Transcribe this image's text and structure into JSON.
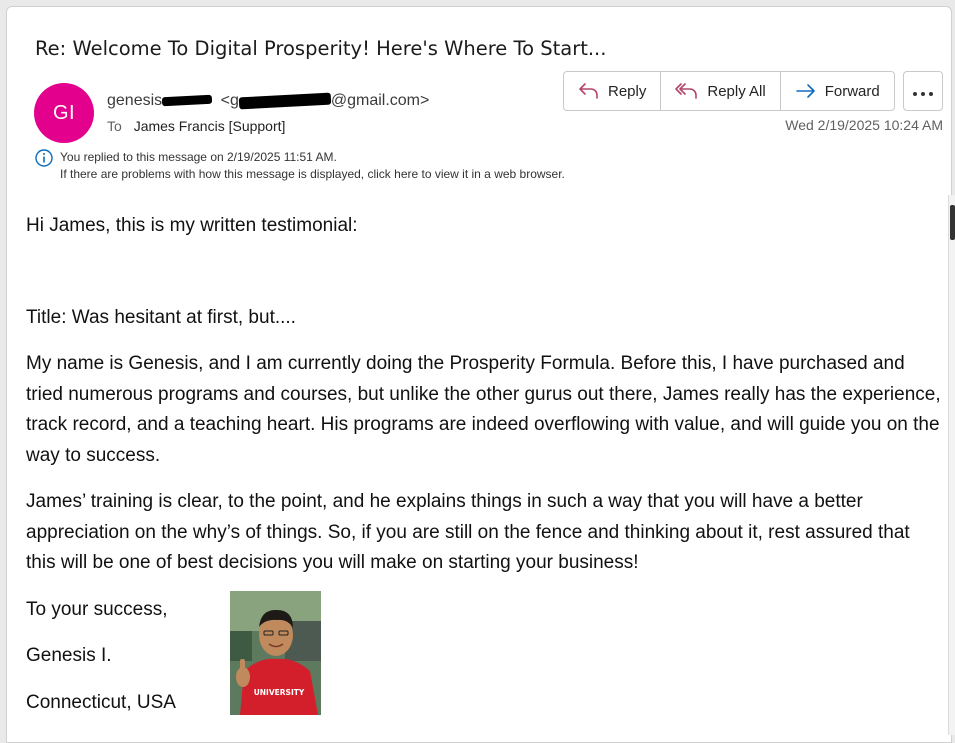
{
  "email": {
    "subject": "Re: Welcome To Digital Prosperity! Here's Where To Start...",
    "avatar_initials": "GI",
    "sender_name_visible": "genesis",
    "sender_email_prefix": "<g",
    "sender_email_suffix": "@gmail.com>",
    "to_label": "To",
    "to_value": "James Francis [Support]",
    "date": "Wed 2/19/2025 10:24 AM",
    "info_line1": "You replied to this message on 2/19/2025 11:51 AM.",
    "info_line2": "If there are problems with how this message is displayed, click here to view it in a web browser."
  },
  "actions": {
    "reply": "Reply",
    "reply_all": "Reply All",
    "forward": "Forward"
  },
  "body": {
    "greeting": "Hi James, this is my written testimonial:",
    "title_line": "Title: Was hesitant at first, but....",
    "para1": "My name is Genesis, and I am currently doing the Prosperity Formula. Before this, I have purchased and tried numerous programs and courses, but unlike the other gurus out there, James really has the experience, track record, and a teaching heart. His programs are indeed overflowing with value, and will guide you on the way to success.",
    "para2": "James’ training is clear, to the point, and he explains things in such a way that you will have a better appreciation on the why’s of things. So, if you are still on the fence and thinking about it, rest assured that this will be one of best decisions you will make on starting your business!",
    "sign_off": "To your success,",
    "signature_name": "Genesis I.",
    "signature_location": "Connecticut, USA",
    "photo_shirt_text": "UNIVERSITY"
  },
  "colors": {
    "avatar": "#e3008c",
    "accent_blue": "#0f6cbd",
    "reply_icon": "#b4446c"
  }
}
